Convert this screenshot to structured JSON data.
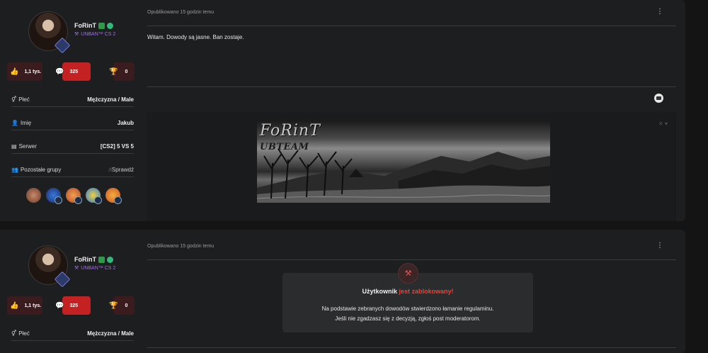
{
  "posts": [
    {
      "author": {
        "username": "FoRinT",
        "group": "UNBAN™ CS 2"
      },
      "stats": {
        "likes": "1,1 tys.",
        "posts": "325",
        "trophies": "0"
      },
      "fields": [
        {
          "label": "Płeć",
          "value": "Mężczyzna / Male",
          "icon": "gender-icon"
        },
        {
          "label": "Imię",
          "value": "Jakub",
          "icon": "person-icon"
        },
        {
          "label": "Serwer",
          "value": "[CS2] 5 VS 5",
          "icon": "server-icon"
        },
        {
          "label": "Pozostałe grupy",
          "value": "Sprawdź",
          "icon": "group-icon"
        }
      ],
      "meta": "Opublikowano 15 godzin temu",
      "message": "Witam. Dowody są jasne. Ban zostaje.",
      "signature": {
        "title": "FoRinT",
        "subtitle": "UBTEAM"
      }
    },
    {
      "author": {
        "username": "FoRinT",
        "group": "UNBAN™ CS 2"
      },
      "stats": {
        "likes": "1,1 tys.",
        "posts": "325",
        "trophies": "0"
      },
      "fields": [
        {
          "label": "Płeć",
          "value": "Mężczyzna / Male",
          "icon": "gender-icon"
        }
      ],
      "meta": "Opublikowano 15 godzin temu",
      "ban_notice": {
        "title_prefix": "Użytkownik ",
        "title_highlight": "jest zablokowany!",
        "line1": "Na podstawie zebranych dowodów stwierdzono łamanie regulaminu.",
        "line2": "Jeśli nie zgadzasz się z decyzją, zgłoś post moderatorom."
      }
    }
  ],
  "colors": {
    "accent": "#c42222",
    "ban_red": "#ff3a2a",
    "group_purple": "#a26cf0"
  }
}
